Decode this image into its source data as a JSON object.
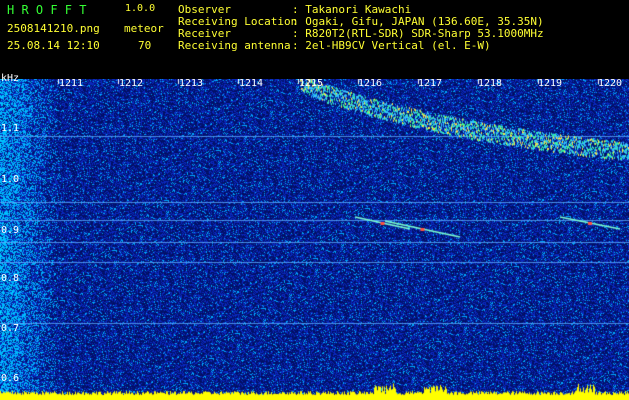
{
  "header": {
    "app_title": "H R O F F T",
    "app_version": "1.0.0",
    "filename": "2508141210.png",
    "timestamp": "25.08.14 12:10",
    "mode_label": "meteor",
    "count": "70"
  },
  "info": {
    "rows": [
      {
        "label": "Observer",
        "value": ": Takanori Kawachi"
      },
      {
        "label": "Receiving Location",
        "value": ": Ogaki, Gifu, JAPAN (136.60E, 35.35N)"
      },
      {
        "label": "Receiver",
        "value": ": R820T2(RTL-SDR) SDR-Sharp 53.1000MHz"
      },
      {
        "label": "Receiving antenna",
        "value": ": 2el-HB9CV Vertical (el. E-W)"
      }
    ]
  },
  "axes": {
    "y_unit": "kHz",
    "y_ticks": [
      "1.1",
      "1.0",
      "0.9",
      "0.8",
      "0.7",
      "0.6"
    ],
    "x_ticks": [
      "1211",
      "1212",
      "1213",
      "1214",
      "1215",
      "1216",
      "1217",
      "1218",
      "1219",
      "1220"
    ]
  },
  "colors": {
    "background": "#000000",
    "header_green": "#34ff34",
    "header_yellow": "#ffff33",
    "axis_white": "#ffffff",
    "spectrum_noise": "#0a1e9a",
    "carrier_lines": "#3fa9ff",
    "baseline_yellow": "#ffff00"
  }
}
